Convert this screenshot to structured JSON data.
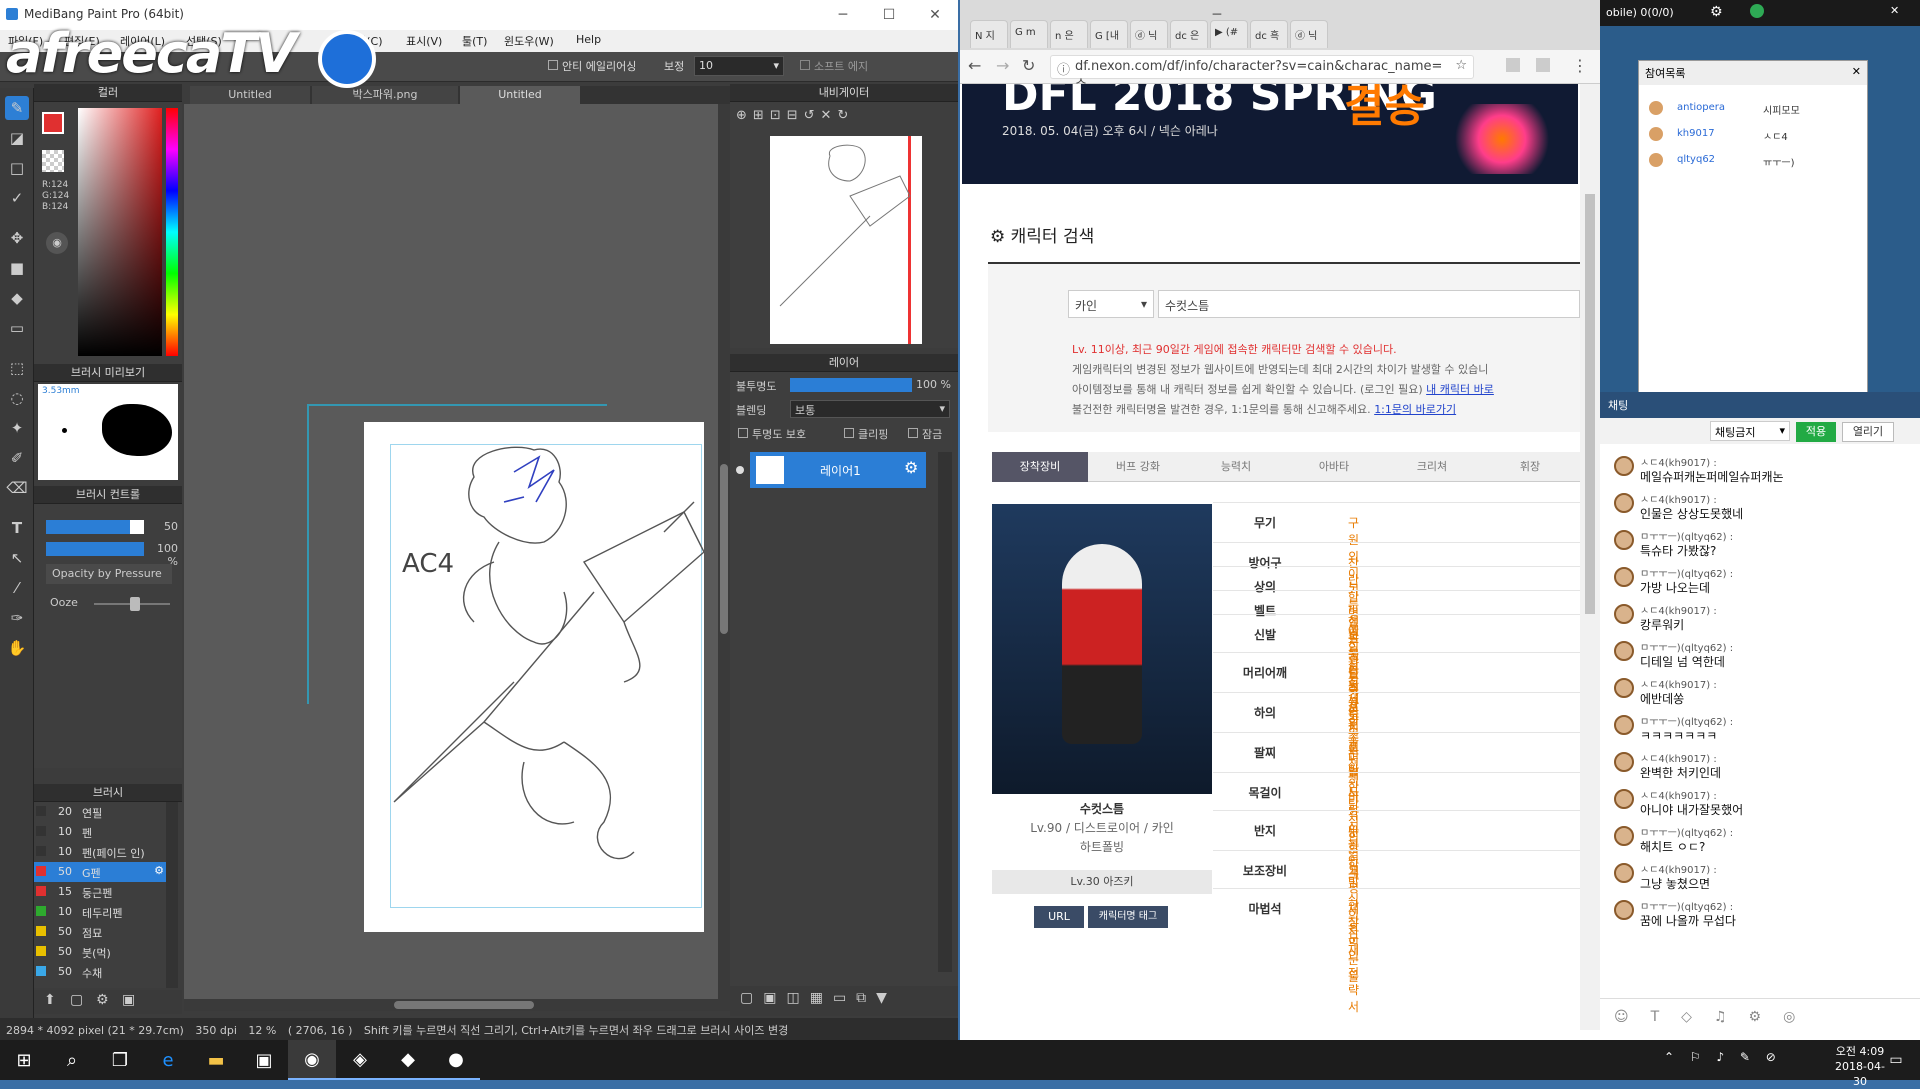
{
  "medibang": {
    "title": "MediBang Paint Pro (64bit)",
    "menu": [
      "파일(F)",
      "편집(E)",
      "레이어(L)",
      "선택(S)",
      "필터(C)",
      "표시(V)",
      "툴(T)",
      "윈도우(W)",
      "Help"
    ],
    "toolbar": {
      "antialias_label": "안티 에일리어싱",
      "correction_label": "보정",
      "correction_value": "10",
      "soft_edge_label": "소프트 에지"
    },
    "tabs": [
      "Untitled",
      "박스파워.png",
      "Untitled"
    ],
    "color_panel": {
      "title": "컬러",
      "r": "R:124",
      "g": "G:124",
      "b": "B:124"
    },
    "brush_preview": {
      "title": "브러시 미리보기",
      "size": "3.53mm"
    },
    "brush_control": {
      "title": "브러시 컨트롤",
      "size": "50",
      "opacity": "100 %",
      "opacity_by_pressure": "Opacity by Pressure",
      "ooze": "Ooze"
    },
    "brush_list": {
      "title": "브러시",
      "items": [
        {
          "size": "20",
          "name": "연필",
          "color": "#333333"
        },
        {
          "size": "10",
          "name": "펜",
          "color": "#333333"
        },
        {
          "size": "10",
          "name": "펜(페이드 인)",
          "color": "#333333"
        },
        {
          "size": "50",
          "name": "G펜",
          "color": "#e03030",
          "selected": true
        },
        {
          "size": "15",
          "name": "둥근펜",
          "color": "#e03030"
        },
        {
          "size": "10",
          "name": "테두리펜",
          "color": "#2eaa2e"
        },
        {
          "size": "50",
          "name": "점묘",
          "color": "#e8c000"
        },
        {
          "size": "50",
          "name": "붓(먹)",
          "color": "#e8c000"
        },
        {
          "size": "50",
          "name": "수채",
          "color": "#3aa8e8"
        }
      ]
    },
    "navigator": {
      "title": "내비게이터"
    },
    "layer_panel": {
      "title": "레이어",
      "opacity_label": "불투명도",
      "opacity_value": "100 %",
      "blend_label": "블렌딩",
      "blend_value": "보통",
      "protect_label": "투명도 보호",
      "clip_label": "클리핑",
      "lock_label": "잠금",
      "layer_name": "레이어1"
    },
    "status": {
      "size": "2894 * 4092 pixel",
      "cm": "(21 * 29.7cm)",
      "dpi": "350 dpi",
      "zoom": "12 %",
      "coord": "( 2706, 16 )",
      "hint": "Shift 키를 누르면서 직선 그리기, Ctrl+Alt키를 누르면서 좌우 드래그로 브러시 사이즈 변경"
    },
    "canvas_text": "AC4"
  },
  "overlay": {
    "logo": "afreecaTV"
  },
  "browser": {
    "url": "df.nexon.com/df/info/character?sv=cain&charac_name=수...",
    "tabs": [
      "N 지",
      "G m",
      "n 은",
      "G [내",
      "ⓓ 닉",
      "dc 은",
      "▶ (#",
      "dc 흑",
      "ⓓ 닉"
    ],
    "banner": {
      "title": "DFL 2018 SPRING",
      "title2": "결승",
      "date": "2018. 05. 04(금) 오후 6시 / 넥슨 아레나"
    },
    "search": {
      "title": "캐릭터 검색",
      "server": "카인",
      "name": "수컷스틈"
    },
    "notices": [
      "Lv. 11이상, 최근 90일간 게임에 접속한 캐릭터만 검색할 수 있습니다.",
      "게임캐릭터의 변경된 정보가 웹사이트에 반영되는데 최대 2시간의 차이가 발생할 수 있습니",
      "아이템정보를 통해 내 캐릭터 정보를 쉽게 확인할 수 있습니다. (로그인 필요)",
      "불건전한 캐릭터명을 발견한 경우, 1:1문의를 통해 신고해주세요."
    ],
    "notice_link1": "내 캐릭터 바로",
    "notice_link2": "1:1문의 바로가기",
    "char_tabs": [
      "장착장비",
      "버프 강화",
      "능력치",
      "아바타",
      "크리쳐",
      "휘장"
    ],
    "character": {
      "name": "수컷스틈",
      "info": "Lv.90 / 디스트로이어 / 카인",
      "guild": "하트폴빙",
      "adventure": "Lv.30 아즈키",
      "btn_url": "URL",
      "btn_tag": "캐릭터명 태그"
    },
    "equipment": [
      {
        "slot": "무기",
        "item": "구원의 이기 - 핸드캐넌"
      },
      {
        "slot": "방어구",
        "item": "찬란한 명예의 상징 세트"
      },
      {
        "slot": "상의",
        "item": "보루신 활공 갑주 상의"
      },
      {
        "slot": "벨트",
        "item": "보루신 활공 갑주 허리"
      },
      {
        "slot": "신발",
        "item": "보루신 활공 갑주 신발"
      },
      {
        "slot": "머리어깨",
        "item": "블랙 포원 숄더패드"
      },
      {
        "slot": "하의",
        "item": "익스포젼 히비 각반"
      },
      {
        "slot": "팔찌",
        "item": "무한한 탐식의 얼개"
      },
      {
        "slot": "목걸이",
        "item": "사랑신 봉인구"
      },
      {
        "slot": "반지",
        "item": "무한한 탐식의 잔재"
      },
      {
        "slot": "보조장비",
        "item": "고평한 장군의 전략서"
      },
      {
        "slot": "마법석",
        "item": "체광의 눈물"
      }
    ]
  },
  "rightpanel": {
    "top_text": "obile) 0(0/0)",
    "participants": {
      "title": "참여목록",
      "list": [
        {
          "nick": "antiopera",
          "msg": "시피모모"
        },
        {
          "nick": "kh9017",
          "msg": "ㅅㄷ4"
        },
        {
          "nick": "qltyq62",
          "msg": "ㅠㅜㅡ)"
        }
      ]
    },
    "chat": {
      "title": "채팅",
      "filter": "채팅금지",
      "apply": "적용",
      "open": "열리기",
      "messages": [
        {
          "nick": "ㅅㄷ4(kh9017) :",
          "msg": "메일슈퍼캐논퍼메일슈퍼캐논"
        },
        {
          "nick": "ㅅㄷ4(kh9017) :",
          "msg": "인물은 상상도못했네"
        },
        {
          "nick": "ㅁㅜㅜㅡ)(qltyq62) :",
          "msg": "특슈타 가봤잖?"
        },
        {
          "nick": "ㅁㅜㅜㅡ)(qltyq62) :",
          "msg": "가방 나오는데"
        },
        {
          "nick": "ㅅㄷ4(kh9017) :",
          "msg": "캉루워키"
        },
        {
          "nick": "ㅁㅜㅜㅡ)(qltyq62) :",
          "msg": "디테일 넘 역한데"
        },
        {
          "nick": "ㅅㄷ4(kh9017) :",
          "msg": "에반데쏭"
        },
        {
          "nick": "ㅁㅜㅜㅡ)(qltyq62) :",
          "msg": "ㅋㅋㅋㅋㅋㅋㅋ"
        },
        {
          "nick": "ㅅㄷ4(kh9017) :",
          "msg": "완벽한 처키인데"
        },
        {
          "nick": "ㅅㄷ4(kh9017) :",
          "msg": "아니야 내가잘못했어"
        },
        {
          "nick": "ㅁㅜㅜㅡ)(qltyq62) :",
          "msg": "해치트 ㅇㄷ?"
        },
        {
          "nick": "ㅅㄷ4(kh9017) :",
          "msg": "그냥 놓쳤으면"
        },
        {
          "nick": "ㅁㅜㅜㅡ)(qltyq62) :",
          "msg": "꿈에 나올까 무섭다"
        }
      ]
    }
  },
  "taskbar": {
    "time": "오전 4:09",
    "date": "2018-04-30"
  }
}
